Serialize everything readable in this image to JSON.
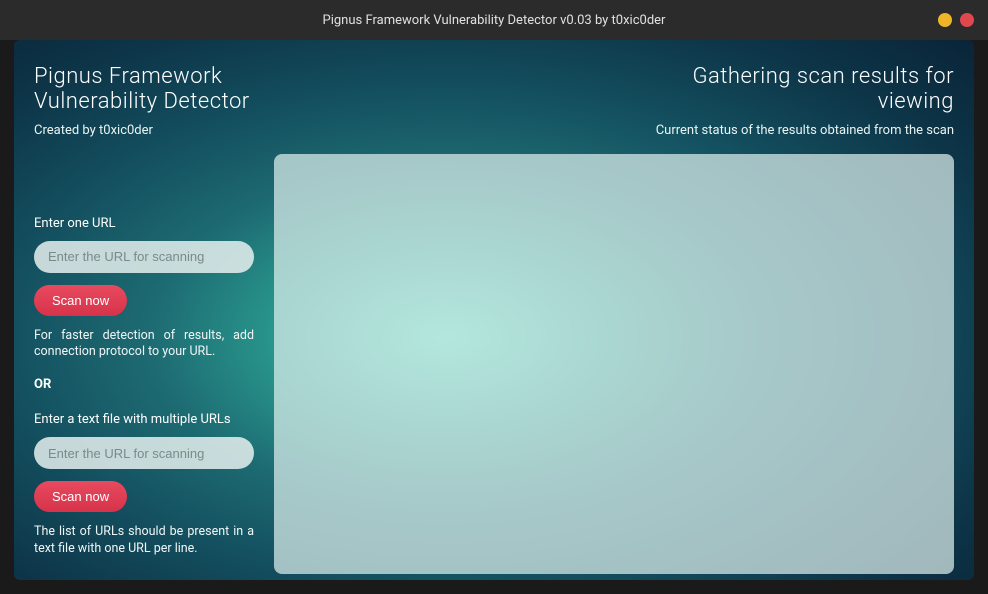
{
  "titlebar": {
    "text": "Pignus Framework Vulnerability Detector v0.03 by t0xic0der"
  },
  "header": {
    "left": {
      "title": "Pignus Framework Vulnerability Detector",
      "subtitle": "Created by t0xic0der"
    },
    "right": {
      "title": "Gathering scan results for viewing",
      "subtitle": "Current status of the results obtained from the scan"
    }
  },
  "sidebar": {
    "single": {
      "label": "Enter one URL",
      "placeholder": "Enter the URL for scanning",
      "button": "Scan now",
      "help": "For faster detection of results, add connection protocol to your URL."
    },
    "divider": "OR",
    "multi": {
      "label": "Enter a text file with multiple URLs",
      "placeholder": "Enter the URL for scanning",
      "button": "Scan now",
      "help": "The list of URLs should be present in a text file with one URL per line."
    }
  }
}
